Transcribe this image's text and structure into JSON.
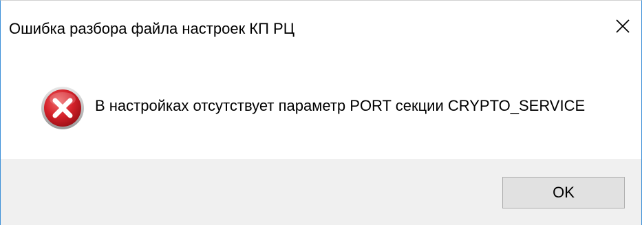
{
  "dialog": {
    "title": "Ошибка разбора файла настроек КП РЦ",
    "message": "В настройках отсутствует параметр PORT секции CRYPTO_SERVICE",
    "icon": "error-icon",
    "ok_label": "OK",
    "close_icon": "close-icon"
  },
  "colors": {
    "accent_border": "#3b8fd8",
    "error_red": "#d4212a",
    "footer_bg": "#f0f0f0",
    "button_bg": "#e1e1e1"
  }
}
